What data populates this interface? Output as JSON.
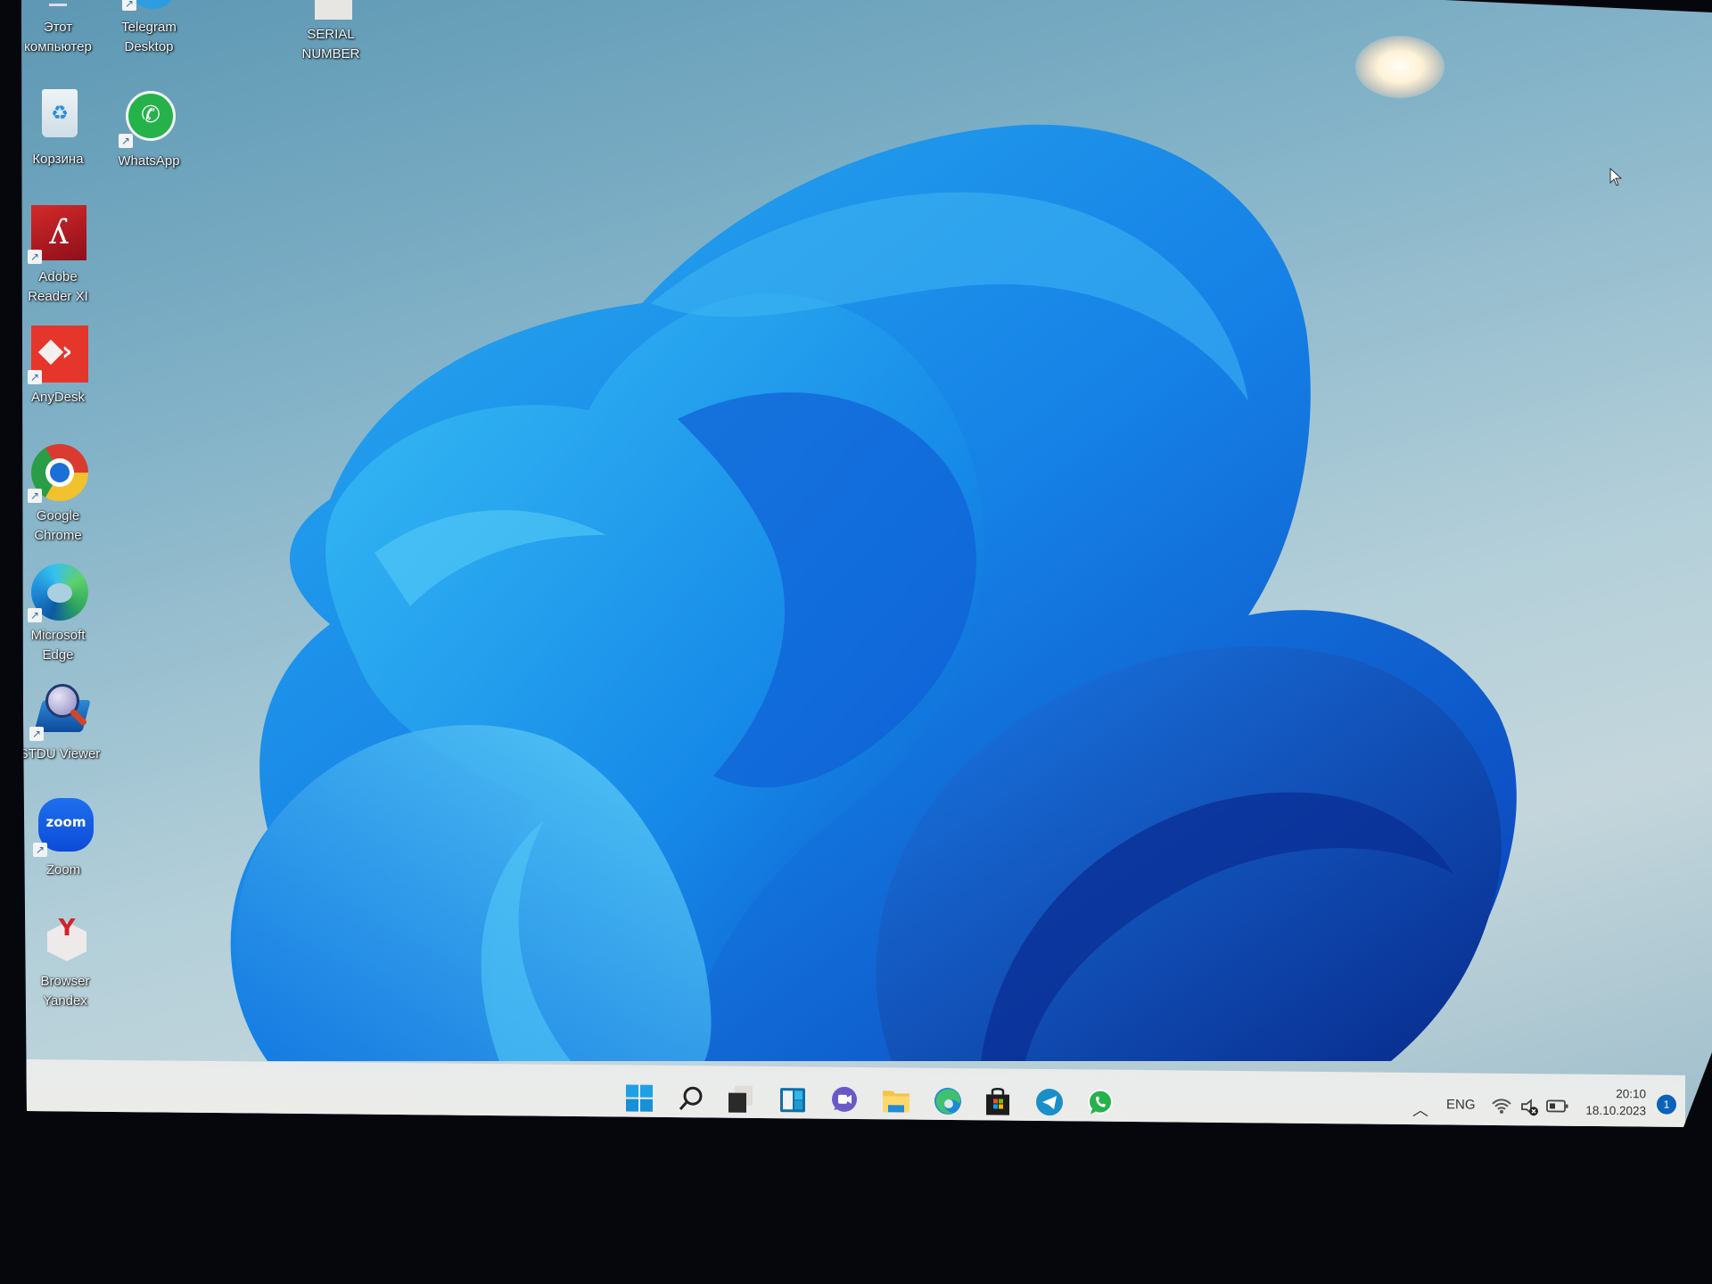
{
  "desktop": {
    "icons": [
      {
        "id": "this-pc",
        "label_line1": "Этот",
        "label_line2": "компьютер"
      },
      {
        "id": "telegram",
        "label_line1": "Telegram",
        "label_line2": "Desktop"
      },
      {
        "id": "serial",
        "label_line1": "SERIAL",
        "label_line2": "NUMBER"
      },
      {
        "id": "recycle-bin",
        "label_line1": "Корзина",
        "label_line2": ""
      },
      {
        "id": "whatsapp",
        "label_line1": "WhatsApp",
        "label_line2": ""
      },
      {
        "id": "adobe",
        "label_line1": "Adobe",
        "label_line2": "Reader XI"
      },
      {
        "id": "anydesk",
        "label_line1": "AnyDesk",
        "label_line2": ""
      },
      {
        "id": "chrome",
        "label_line1": "Google",
        "label_line2": "Chrome"
      },
      {
        "id": "edge",
        "label_line1": "Microsoft",
        "label_line2": "Edge"
      },
      {
        "id": "stdu",
        "label_line1": "STDU Viewer",
        "label_line2": ""
      },
      {
        "id": "zoom",
        "label_line1": "Zoom",
        "label_line2": ""
      },
      {
        "id": "yandex",
        "label_line1": "Browser",
        "label_line2": "Yandex"
      }
    ],
    "zoom_icon_text": "zoom"
  },
  "taskbar": {
    "pinned": [
      "Start",
      "Search",
      "Task View",
      "Widgets",
      "Chat",
      "File Explorer",
      "Microsoft Edge",
      "Microsoft Store",
      "Telegram",
      "WhatsApp"
    ],
    "tray": {
      "language": "ENG",
      "time": "20:10",
      "date": "18.10.2023",
      "notification_count": "1"
    }
  },
  "colors": {
    "accent": "#0067c0",
    "wallpaper_blue": "#1a73e8",
    "taskbar_bg": "#ebecec"
  }
}
